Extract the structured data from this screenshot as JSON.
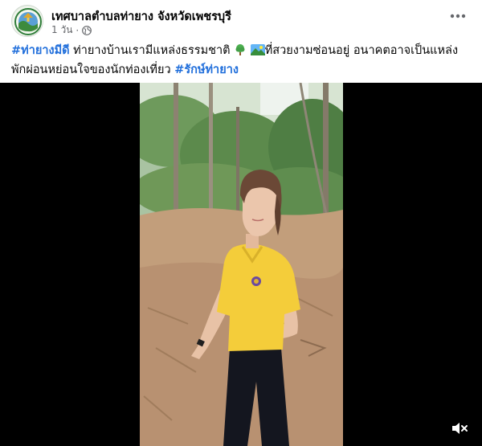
{
  "post": {
    "page_name": "เทศบาลตำบลท่ายาง จังหวัดเพชรบุรี",
    "timestamp": "1 วัน",
    "separator": "·",
    "privacy_icon": "globe-icon",
    "more_icon": "more-options-icon",
    "caption": {
      "hashtag_1": "#ท่ายางมีดี",
      "text_1": " ท่ายางบ้านเรามีแหล่งธรรมชาติ ",
      "emoji_1": "tree-emoji",
      "emoji_2": "landscape-emoji",
      "text_2": "ที่สวยงามซ่อนอยู่ อนาคตอาจเป็นแหล่ง",
      "text_3": "พักผ่อนหย่อนใจของนักท่องเที่ยว  ",
      "hashtag_2": "#รักษ์ท่ายาง"
    }
  },
  "video": {
    "mute_icon": "speaker-mute-icon",
    "background": "#000000"
  },
  "colors": {
    "hashtag": "#216fdb",
    "secondary_text": "#65676b",
    "shirt": "#f4cd3a"
  }
}
